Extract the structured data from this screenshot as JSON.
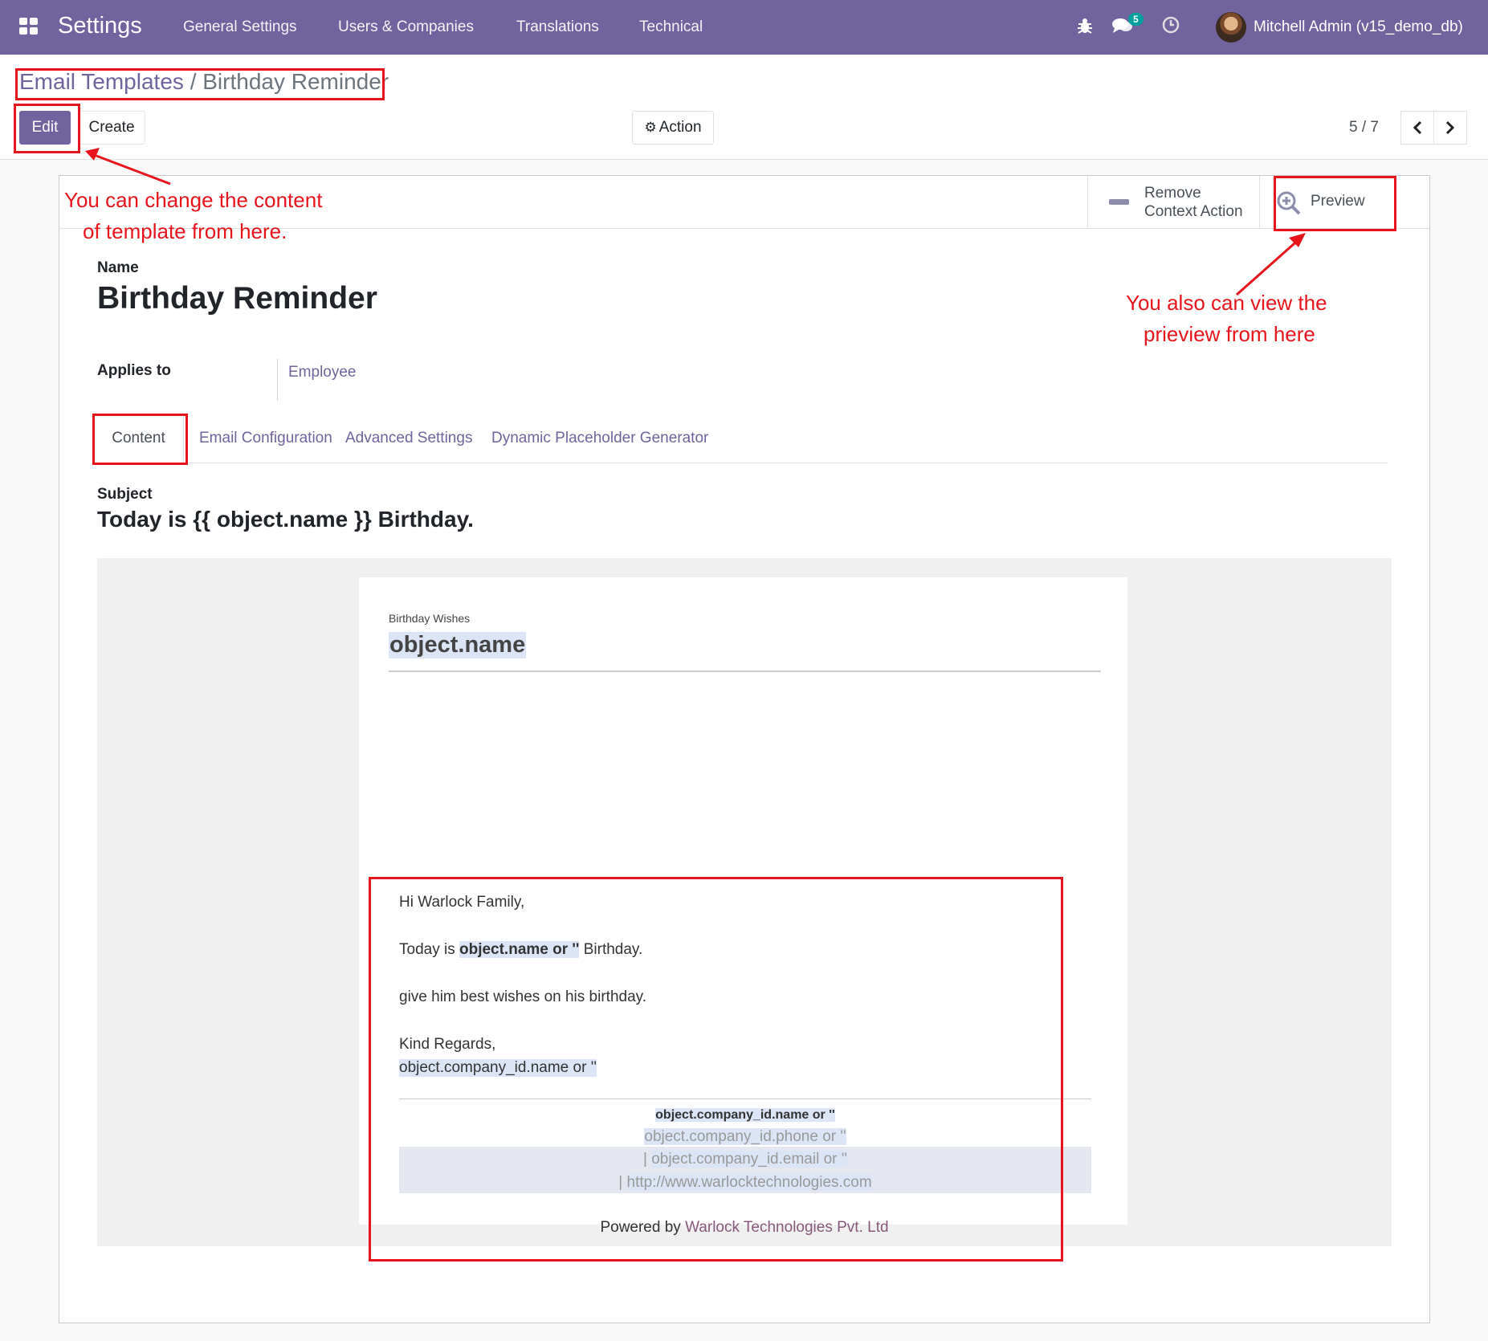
{
  "navbar": {
    "brand": "Settings",
    "menu": [
      "General Settings",
      "Users & Companies",
      "Translations",
      "Technical"
    ],
    "messages_count": "5",
    "user": "Mitchell Admin (v15_demo_db)"
  },
  "breadcrumb": {
    "parent": "Email Templates",
    "separator": "/",
    "current": "Birthday Reminder"
  },
  "buttons": {
    "edit": "Edit",
    "create": "Create",
    "action": "Action"
  },
  "pager": {
    "value": "5 / 7"
  },
  "smart_buttons": {
    "remove_line1": "Remove",
    "remove_line2": "Context Action",
    "preview": "Preview"
  },
  "form": {
    "name_label": "Name",
    "name_value": "Birthday Reminder",
    "applies_label": "Applies to",
    "applies_value": "Employee",
    "tabs": [
      "Content",
      "Email Configuration",
      "Advanced Settings",
      "Dynamic Placeholder Generator"
    ],
    "subject_label": "Subject",
    "subject_value": "Today is {{ object.name }} Birthday."
  },
  "email": {
    "header_label": "Birthday Wishes",
    "header_name": "object.name",
    "greeting": "Hi Warlock Family,",
    "today_prefix": "Today is ",
    "today_placeholder": "object.name or ''",
    "today_suffix": " Birthday.",
    "wishes": "give him best wishes on his birthday.",
    "regards": "Kind Regards,",
    "signature": "object.company_id.name or ''",
    "footer_company": "object.company_id.name or ''",
    "footer_phone": "object.company_id.phone or ''",
    "footer_email_prefix": "| ",
    "footer_email": "object.company_id.email or ''",
    "footer_web_prefix": "| ",
    "footer_web": "http://www.warlocktechnologies.com",
    "powered_prefix": "Powered by ",
    "powered_link": "Warlock Technologies Pvt. Ltd"
  },
  "annotations": {
    "edit_note_1": "You can change the content",
    "edit_note_2": "of template from here.",
    "preview_note_1": "You also can view the",
    "preview_note_2": "prieview from here"
  },
  "icons": {
    "apps": "apps-grid-icon",
    "bug": "bug-icon",
    "chat": "chat-icon",
    "clock": "clock-icon",
    "gear": "gear-icon",
    "prev": "chevron-left-icon",
    "next": "chevron-right-icon",
    "minus": "minus-icon",
    "preview": "zoom-in-icon"
  },
  "colors": {
    "brand": "#71639e",
    "annotation": "#e8141c",
    "badge": "#00a09d",
    "placeholder_highlight": "#dbe5f5"
  }
}
